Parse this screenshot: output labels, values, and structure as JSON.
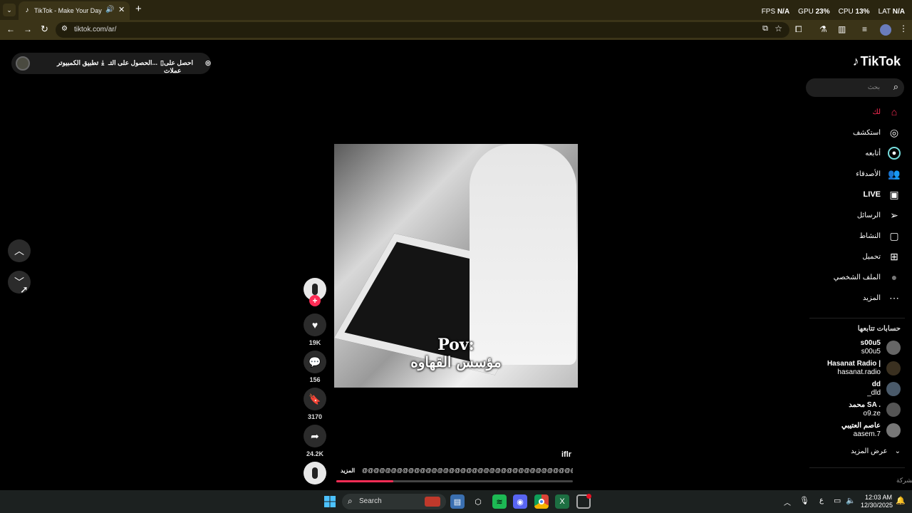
{
  "browser": {
    "tab_title": "TikTok - Make Your Day",
    "url": "tiktok.com/ar/",
    "stats": {
      "fps_label": "FPS",
      "fps_value": "N/A",
      "gpu_label": "GPU",
      "gpu_value": "23%",
      "cpu_label": "CPU",
      "cpu_value": "13%",
      "lat_label": "LAT",
      "lat_value": "N/A"
    }
  },
  "topbar": {
    "coins": "احصل على عملات",
    "get_app": "الحصول على التـ...",
    "desktop_app": "تطبيق الكمبيوتر"
  },
  "sidebar": {
    "logo": "TikTok",
    "search_placeholder": "بحث",
    "nav": [
      {
        "label": "لك",
        "icon": "home-icon",
        "active": true
      },
      {
        "label": "استكشف",
        "icon": "compass-icon"
      },
      {
        "label": "أتابعه",
        "icon": "following-icon"
      },
      {
        "label": "الأصدقاء",
        "icon": "friends-icon"
      },
      {
        "label": "LIVE",
        "icon": "live-icon"
      },
      {
        "label": "الرسائل",
        "icon": "messages-icon"
      },
      {
        "label": "النشاط",
        "icon": "activity-icon"
      },
      {
        "label": "تحميل",
        "icon": "upload-icon"
      },
      {
        "label": "الملف الشخصي",
        "icon": "profile-avatar-icon"
      },
      {
        "label": "المزيد",
        "icon": "more-icon"
      }
    ],
    "following_title": "حسابات تتابعها",
    "accounts": [
      {
        "name": "s00u5",
        "handle": "s00u5"
      },
      {
        "name": "Hasanat Radio |",
        "handle": "hasanat.radio"
      },
      {
        "name": "dd",
        "handle": "_dld"
      },
      {
        "name": "محمد SA .",
        "handle": "o9.ze"
      },
      {
        "name": "عاصم العتيبي",
        "handle": "aasem.7"
      }
    ],
    "show_more": "عرض المزيد",
    "company": "الشركة"
  },
  "video": {
    "caption_line1": "Pov:",
    "caption_line2": "مؤسس القهاوه",
    "author": "iflr",
    "description": "@@@@@@@@@@@@@@@@@@@@@@@@@@@@@@@@@@@@@@@@@@@@@@ه",
    "more": "المزيد",
    "progress": 0.24
  },
  "actions": {
    "likes": "19K",
    "comments": "156",
    "bookmarks": "3170",
    "shares": "24.2K"
  },
  "taskbar": {
    "search": "Search",
    "time": "12:03 AM",
    "date": "12/30/2025",
    "lang": "ع"
  },
  "colors": {
    "accent": "#fe2c55",
    "browser_tabbar": "#2a2510",
    "browser_toolbar": "#3b3418",
    "taskbar": "#1c2120"
  }
}
